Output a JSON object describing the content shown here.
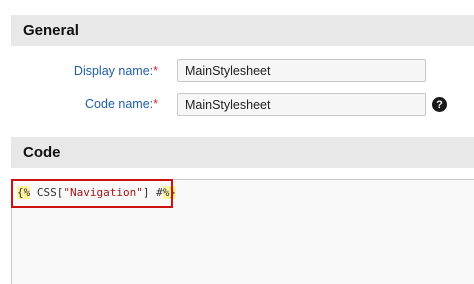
{
  "general_section": {
    "title": "General"
  },
  "form": {
    "display_name": {
      "label": "Display name:",
      "required_mark": "*",
      "value": "MainStylesheet"
    },
    "code_name": {
      "label": "Code name:",
      "required_mark": "*",
      "value": "MainStylesheet"
    },
    "help_icon": "question-circle-icon",
    "help_glyph": "?"
  },
  "code_section": {
    "title": "Code"
  },
  "code": {
    "macro_open": "{%",
    "call_prefix": " CSS[",
    "string_literal": "\"Navigation\"",
    "call_suffix": "] #",
    "macro_close": "%}"
  },
  "colors": {
    "label_blue": "#1f5fa6",
    "required_red": "#d03030",
    "header_gray": "#e8e8e8",
    "highlight_red": "#cc1111",
    "macro_yellow": "#fff3a0"
  }
}
